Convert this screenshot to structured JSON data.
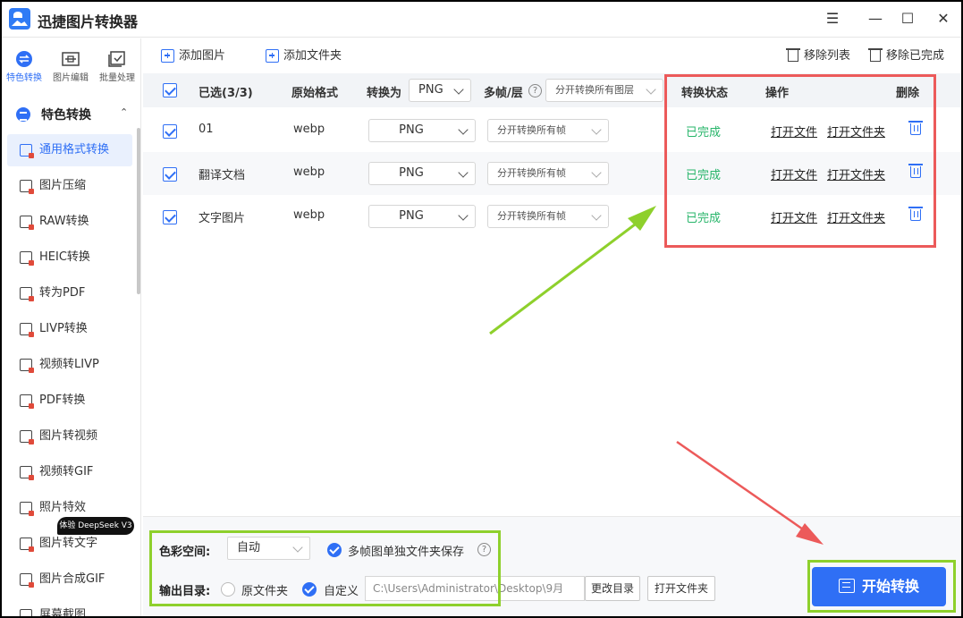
{
  "app": {
    "title": "迅捷图片转换器"
  },
  "window_controls": {
    "menu": "☰",
    "minimize": "—",
    "maximize": "☐",
    "close": "✕"
  },
  "mode_tabs": [
    {
      "label": "特色转换",
      "icon": "feature-convert-icon",
      "active": true
    },
    {
      "label": "图片编辑",
      "icon": "image-edit-icon",
      "active": false
    },
    {
      "label": "批量处理",
      "icon": "batch-process-icon",
      "active": false
    }
  ],
  "sidebar": {
    "category": "特色转换",
    "items": [
      {
        "label": "通用格式转换",
        "active": true
      },
      {
        "label": "图片压缩"
      },
      {
        "label": "RAW转换"
      },
      {
        "label": "HEIC转换"
      },
      {
        "label": "转为PDF"
      },
      {
        "label": "LIVP转换"
      },
      {
        "label": "视频转LIVP"
      },
      {
        "label": "PDF转换"
      },
      {
        "label": "图片转视频"
      },
      {
        "label": "视频转GIF"
      },
      {
        "label": "照片特效"
      },
      {
        "label": "图片转文字"
      },
      {
        "label": "图片合成GIF"
      },
      {
        "label": "屏幕截图"
      }
    ],
    "badge": "体验 DeepSeek V3"
  },
  "toolbar": {
    "add_image": "添加图片",
    "add_folder": "添加文件夹",
    "remove_list": "移除列表",
    "remove_done": "移除已完成"
  },
  "table": {
    "headers": {
      "selected": "已选(3/3)",
      "original_format": "原始格式",
      "convert_to": "转换为",
      "convert_to_value": "PNG",
      "multi_frame": "多帧/层",
      "multi_frame_value": "分开转换所有图层",
      "status": "转换状态",
      "action": "操作",
      "delete": "删除"
    },
    "rows": [
      {
        "name": "01",
        "format": "webp",
        "target": "PNG",
        "frames": "分开转换所有帧",
        "status": "已完成",
        "open_file": "打开文件",
        "open_folder": "打开文件夹"
      },
      {
        "name": "翻译文档",
        "format": "webp",
        "target": "PNG",
        "frames": "分开转换所有帧",
        "status": "已完成",
        "open_file": "打开文件",
        "open_folder": "打开文件夹"
      },
      {
        "name": "文字图片",
        "format": "webp",
        "target": "PNG",
        "frames": "分开转换所有帧",
        "status": "已完成",
        "open_file": "打开文件",
        "open_folder": "打开文件夹"
      }
    ]
  },
  "bottom": {
    "color_space_label": "色彩空间:",
    "color_space_value": "自动",
    "multi_frame_folder": "多帧图单独文件夹保存",
    "output_label": "输出目录:",
    "original_folder": "原文件夹",
    "custom": "自定义",
    "path": "C:\\Users\\Administrator\\Desktop\\9月",
    "change_dir": "更改目录",
    "open_folder": "打开文件夹",
    "start": "开始转换"
  },
  "colors": {
    "accent": "#2f6ff5",
    "success": "#27b56a",
    "highlight_red": "#ec5a5a",
    "highlight_green": "#8ed02c"
  }
}
